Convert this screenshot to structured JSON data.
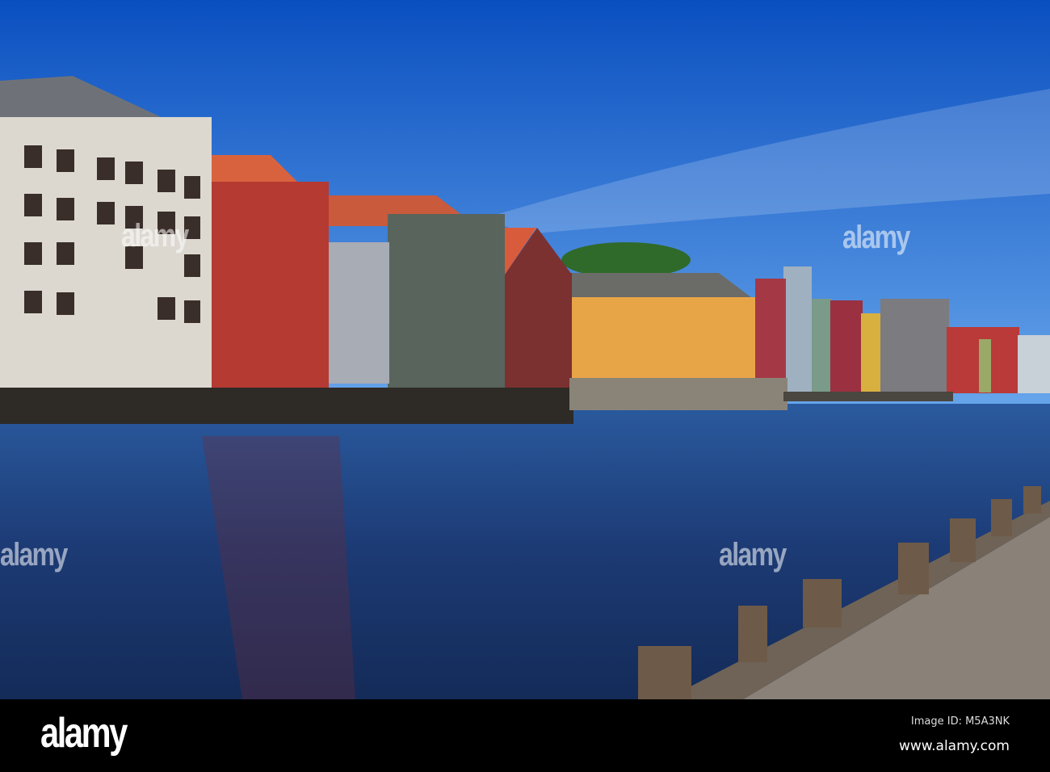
{
  "photo": {
    "subject": "Colorful wooden wharf warehouses along a river with a wooden boardwalk",
    "colors": {
      "sky_top": "#0a4fc0",
      "sky_bottom": "#5fa2ea",
      "water": "#1d3d78",
      "pier": "#8a8178"
    }
  },
  "watermark": {
    "text": "alamy"
  },
  "footer": {
    "logo": "alamy",
    "image_id": "Image ID: M5A3NK",
    "website": "www.alamy.com"
  }
}
